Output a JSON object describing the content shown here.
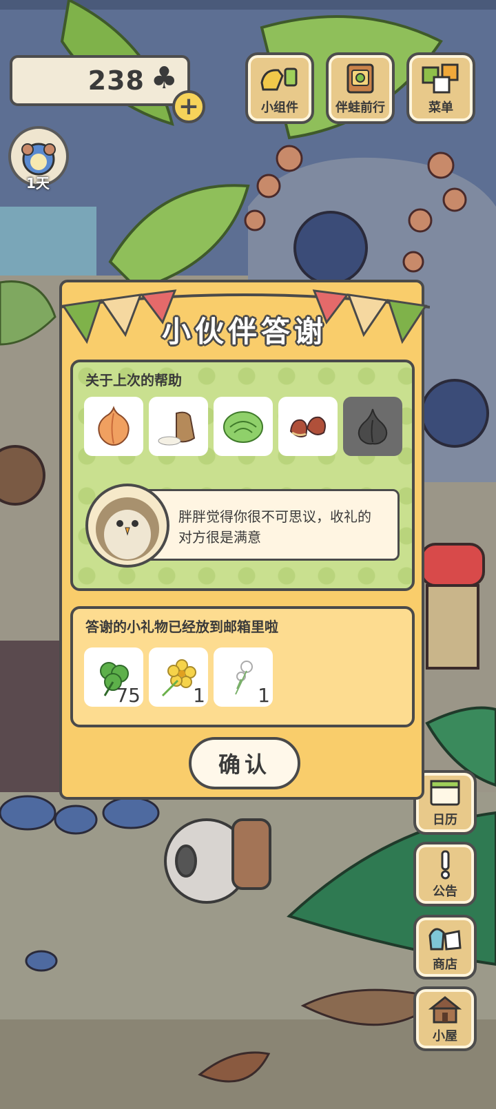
{
  "hud": {
    "clover_count": "238",
    "plus_label": "+",
    "day_label": "1天"
  },
  "top_menu": [
    {
      "label": "小组件",
      "icon": "widget-icon"
    },
    {
      "label": "伴蛙前行",
      "icon": "frog-journey-icon"
    },
    {
      "label": "菜单",
      "icon": "menu-icon"
    }
  ],
  "side_menu": [
    {
      "label": "日历",
      "icon": "calendar-icon"
    },
    {
      "label": "公告",
      "icon": "notice-icon"
    },
    {
      "label": "商店",
      "icon": "shop-icon"
    },
    {
      "label": "小屋",
      "icon": "house-icon"
    }
  ],
  "dialog": {
    "title": "小伙伴答谢",
    "help_heading": "关于上次的帮助",
    "help_items": [
      {
        "name": "onion-icon",
        "selected": false
      },
      {
        "name": "rice-sack-icon",
        "selected": false
      },
      {
        "name": "cabbage-icon",
        "selected": false
      },
      {
        "name": "chestnut-icon",
        "selected": false
      },
      {
        "name": "garlic-icon",
        "selected": true
      }
    ],
    "message_line1": "胖胖觉得你很不可思议，收礼的",
    "message_line2": "对方很是满意",
    "gift_heading": "答谢的小礼物已经放到邮箱里啦",
    "gifts": [
      {
        "icon": "clover-icon",
        "qty": "75"
      },
      {
        "icon": "yellow-flower-icon",
        "qty": "1"
      },
      {
        "icon": "dandelion-icon",
        "qty": "1"
      }
    ],
    "confirm_label": "确认"
  },
  "colors": {
    "dialog_bg": "#f9cd6b",
    "help_panel_bg": "#c9e08f",
    "gift_panel_bg": "#fddc90",
    "outline": "#4a4a4a"
  }
}
